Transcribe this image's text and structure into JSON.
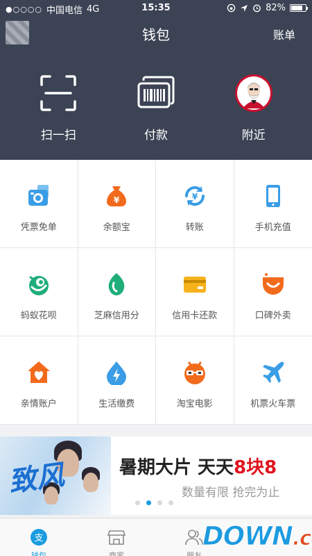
{
  "status": {
    "carrier": "中国电信",
    "network": "4G",
    "time": "15:35",
    "battery": "82%",
    "battery_level": 0.82
  },
  "nav": {
    "title": "钱包",
    "right_label": "账单"
  },
  "hero": [
    {
      "label": "扫一扫",
      "icon": "scan-icon"
    },
    {
      "label": "付款",
      "icon": "barcode-icon"
    },
    {
      "label": "附近",
      "icon": "kfc-logo-icon"
    }
  ],
  "grid": [
    {
      "label": "凭票免单",
      "icon": "camera-ticket-icon",
      "color": "#3a9de5"
    },
    {
      "label": "余额宝",
      "icon": "money-bag-icon",
      "color": "#f26b1d"
    },
    {
      "label": "转账",
      "icon": "transfer-yuan-icon",
      "color": "#3a9de5"
    },
    {
      "label": "手机充值",
      "icon": "mobile-phone-icon",
      "color": "#3a9de5"
    },
    {
      "label": "蚂蚁花呗",
      "icon": "huabei-icon",
      "color": "#1fae7a"
    },
    {
      "label": "芝麻信用分",
      "icon": "sesame-icon",
      "color": "#1fae7a"
    },
    {
      "label": "信用卡还款",
      "icon": "credit-card-icon",
      "color": "#f6b21b"
    },
    {
      "label": "口碑外卖",
      "icon": "takeout-icon",
      "color": "#f26b1d"
    },
    {
      "label": "亲情账户",
      "icon": "family-house-icon",
      "color": "#f26b1d"
    },
    {
      "label": "生活缴费",
      "icon": "utility-drop-icon",
      "color": "#3a9de5"
    },
    {
      "label": "淘宝电影",
      "icon": "movie-face-icon",
      "color": "#f26b1d"
    },
    {
      "label": "机票火车票",
      "icon": "airplane-icon",
      "color": "#3a9de5"
    }
  ],
  "banner": {
    "logo_text": "致风",
    "title_prefix": "暑期大片 天天",
    "title_highlight": "8块8",
    "subtitle": "数量有限  抢完为止",
    "dot_count": 4,
    "active_dot": 1
  },
  "tabs": [
    {
      "label": "钱包",
      "icon": "alipay-icon",
      "active": true
    },
    {
      "label": "商家",
      "icon": "store-icon",
      "active": false
    },
    {
      "label": "朋友",
      "icon": "friends-icon",
      "active": false
    },
    {
      "label": "",
      "icon": "",
      "active": false
    }
  ],
  "watermark": {
    "main": "DOWN",
    "suffix": ".cc"
  },
  "colors": {
    "header_bg": "#3b4354",
    "accent": "#1a9cdf",
    "highlight_red": "#e0141e"
  }
}
